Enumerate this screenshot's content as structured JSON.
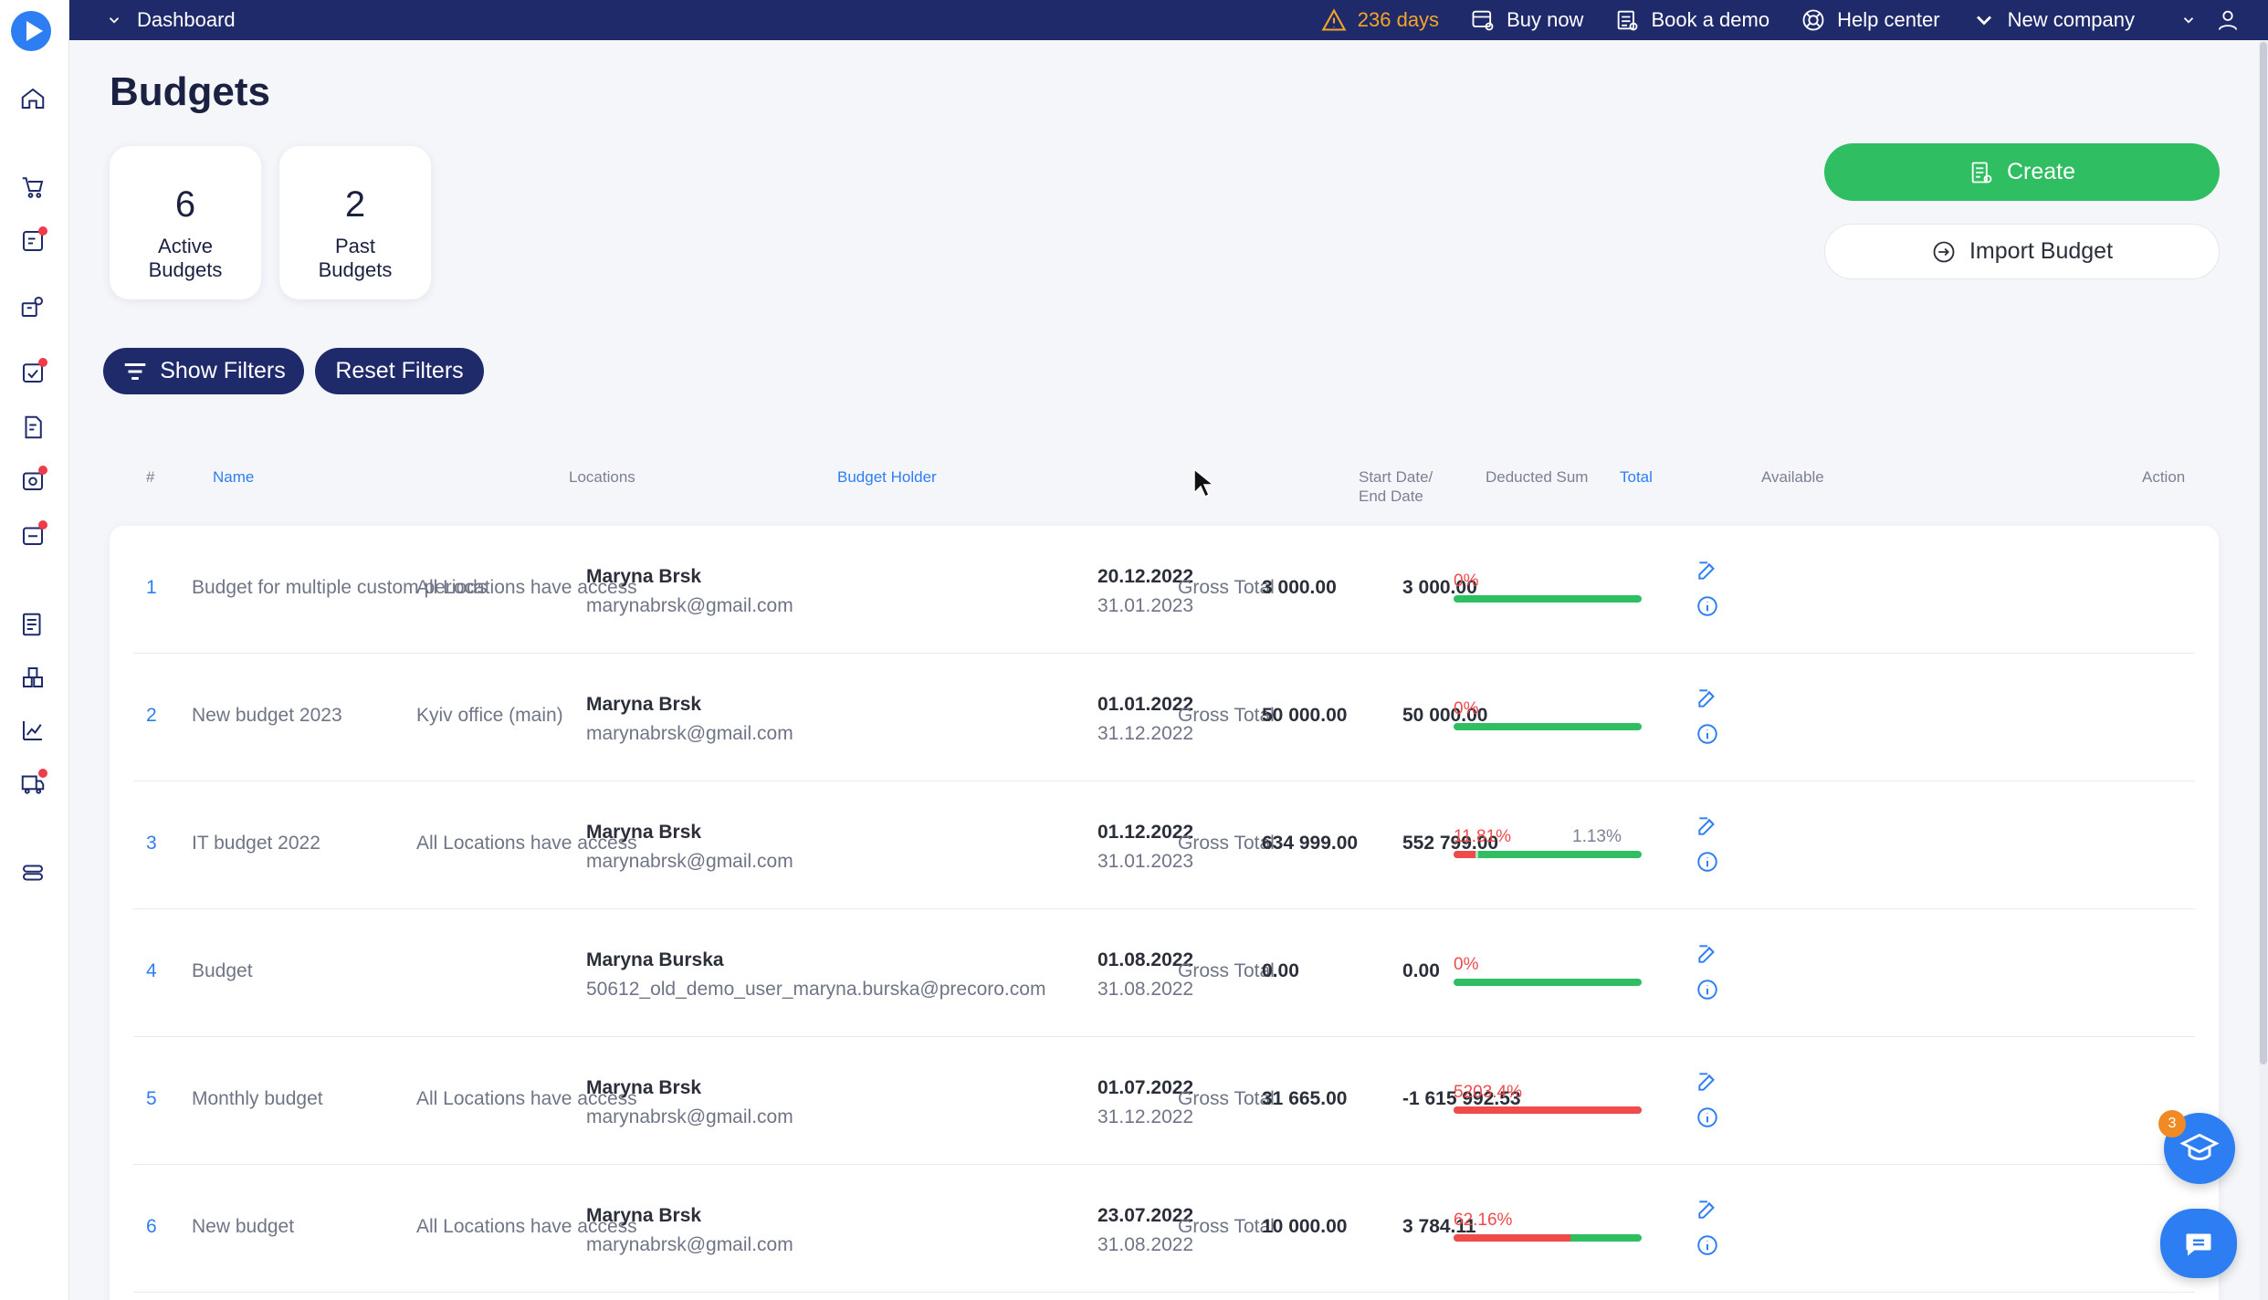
{
  "topbar": {
    "breadcrumb": "Dashboard",
    "trial": "236 days",
    "buy_now": "Buy now",
    "book_demo": "Book a demo",
    "help_center": "Help center",
    "company": "New company"
  },
  "sidebar": {
    "icons": [
      "home-icon",
      "cart-icon",
      "approvals-icon",
      "suppliers-icon",
      "tasks-icon",
      "invoices-icon",
      "receipts-icon",
      "payments-icon",
      "budgets-icon",
      "warehouse-icon",
      "analytics-icon",
      "delivery-icon",
      "settings-icon"
    ]
  },
  "page": {
    "title": "Budgets",
    "active_count": "6",
    "active_label": "Active Budgets",
    "past_count": "2",
    "past_label": "Past Budgets",
    "create_label": "Create",
    "import_label": "Import Budget",
    "show_filters": "Show Filters",
    "reset_filters": "Reset Filters"
  },
  "table": {
    "headers": {
      "idx": "#",
      "name": "Name",
      "locations": "Locations",
      "holder": "Budget Holder",
      "dates_1": "Start Date/",
      "dates_2": "End Date",
      "deducted": "Deducted Sum",
      "total": "Total",
      "available": "Available",
      "action": "Action"
    },
    "rows": [
      {
        "idx": "1",
        "name": "Budget for multiple custom periods",
        "locations": "All Locations have access",
        "holder": "Maryna Brsk",
        "email": "marynabrsk@gmail.com",
        "start": "20.12.2022",
        "end": "31.01.2023",
        "deducted": "Gross Total",
        "total": "3 000.00",
        "available": "3 000.00",
        "pct": "0%",
        "pct2": "",
        "used": 0,
        "pending": 0
      },
      {
        "idx": "2",
        "name": "New budget 2023",
        "locations": "Kyiv office (main)",
        "holder": "Maryna Brsk",
        "email": "marynabrsk@gmail.com",
        "start": "01.01.2022",
        "end": "31.12.2022",
        "deducted": "Gross Total",
        "total": "50 000.00",
        "available": "50 000.00",
        "pct": "0%",
        "pct2": "",
        "used": 0,
        "pending": 0
      },
      {
        "idx": "3",
        "name": "IT budget 2022",
        "locations": "All Locations have access",
        "holder": "Maryna Brsk",
        "email": "marynabrsk@gmail.com",
        "start": "01.12.2022",
        "end": "31.01.2023",
        "deducted": "Gross Total",
        "total": "634 999.00",
        "available": "552 799.00",
        "pct": "11.81%",
        "pct2": "1.13%",
        "used": 0.1181,
        "pending": 0.0113
      },
      {
        "idx": "4",
        "name": "Budget",
        "locations": "",
        "holder": "Maryna Burska",
        "email": "50612_old_demo_user_maryna.burska@precoro.com",
        "start": "01.08.2022",
        "end": "31.08.2022",
        "deducted": "Gross Total",
        "total": "0.00",
        "available": "0.00",
        "pct": "0%",
        "pct2": "",
        "used": 0,
        "pending": 0
      },
      {
        "idx": "5",
        "name": "Monthly budget",
        "locations": "All Locations have access",
        "holder": "Maryna Brsk",
        "email": "marynabrsk@gmail.com",
        "start": "01.07.2022",
        "end": "31.12.2022",
        "deducted": "Gross Total",
        "total": "31 665.00",
        "available": "-1 615 992.53",
        "pct": "5203.4%",
        "pct2": "",
        "used": 1,
        "pending": 0
      },
      {
        "idx": "6",
        "name": "New budget",
        "locations": "All Locations have access",
        "holder": "Maryna Brsk",
        "email": "marynabrsk@gmail.com",
        "start": "23.07.2022",
        "end": "31.08.2022",
        "deducted": "Gross Total",
        "total": "10 000.00",
        "available": "3 784.11",
        "pct": "62.16%",
        "pct2": "",
        "used": 0.6216,
        "pending": 0
      }
    ]
  },
  "widgets": {
    "edu_badge": "3"
  },
  "colors": {
    "navy": "#1f2a6b",
    "accent": "#2e7ef3",
    "green": "#2fbf62",
    "red": "#ef4b4b",
    "warning": "#f5a524"
  }
}
